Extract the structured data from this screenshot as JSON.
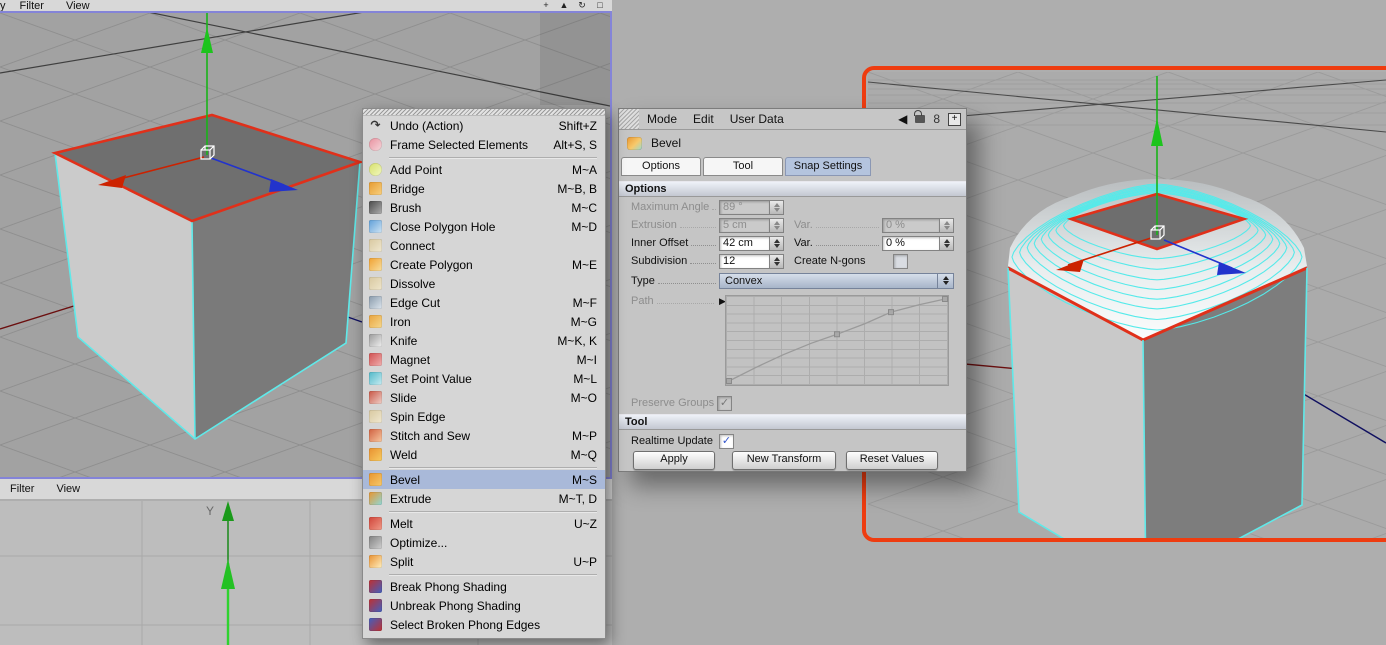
{
  "left_viewport": {
    "menu": [
      "y",
      "Filter",
      "View"
    ],
    "corner_icons": [
      {
        "name": "pan-icon",
        "glyph": "+"
      },
      {
        "name": "zoom-icon",
        "glyph": "▲"
      },
      {
        "name": "rotate-icon",
        "glyph": "↻"
      },
      {
        "name": "maximize-icon",
        "glyph": "□"
      }
    ]
  },
  "bottom_viewport": {
    "menu": [
      "Filter",
      "View"
    ],
    "y_axis_label": "Y"
  },
  "context_menu": {
    "items": [
      {
        "id": "undo",
        "label": "Undo (Action)",
        "shortcut": "Shift+Z",
        "icon": "undo-icon",
        "glyph": "↷",
        "fg": "#333"
      },
      {
        "id": "frame-selected-elements",
        "label": "Frame Selected Elements",
        "shortcut": "Alt+S, S",
        "icon": "frame-selected-icon",
        "c1": "#e8909e",
        "c2": "#f6d8dc",
        "round": true
      },
      {
        "sep": true
      },
      {
        "id": "add-point",
        "label": "Add Point",
        "shortcut": "M~A",
        "icon": "add-point-icon",
        "c1": "#d6e06a",
        "c2": "#f2f8c0",
        "round": true
      },
      {
        "id": "bridge",
        "label": "Bridge",
        "shortcut": "M~B, B",
        "icon": "bridge-icon",
        "c1": "#e69b30",
        "c2": "#f8d080"
      },
      {
        "id": "brush",
        "label": "Brush",
        "shortcut": "M~C",
        "icon": "brush-icon",
        "c1": "#4a4a4a",
        "c2": "#b0b0b0"
      },
      {
        "id": "close-polygon-hole",
        "label": "Close Polygon Hole",
        "shortcut": "M~D",
        "icon": "close-polygon-hole-icon",
        "c1": "#5f9fd8",
        "c2": "#cfe4f4"
      },
      {
        "id": "connect",
        "label": "Connect",
        "shortcut": "",
        "icon": "connect-icon",
        "c1": "#d8c8a0",
        "c2": "#f0e8d0"
      },
      {
        "id": "create-polygon",
        "label": "Create Polygon",
        "shortcut": "M~E",
        "icon": "create-polygon-icon",
        "c1": "#f0a030",
        "c2": "#f8e0a0"
      },
      {
        "id": "dissolve",
        "label": "Dissolve",
        "shortcut": "",
        "icon": "dissolve-icon",
        "c1": "#d8c8a0",
        "c2": "#efe6cc"
      },
      {
        "id": "edge-cut",
        "label": "Edge Cut",
        "shortcut": "M~F",
        "icon": "edge-cut-icon",
        "c1": "#8899aa",
        "c2": "#dde6ee"
      },
      {
        "id": "iron",
        "label": "Iron",
        "shortcut": "M~G",
        "icon": "iron-icon",
        "c1": "#e8a33d",
        "c2": "#f6d88e"
      },
      {
        "id": "knife",
        "label": "Knife",
        "shortcut": "M~K, K",
        "icon": "knife-icon",
        "c1": "#9a9a9a",
        "c2": "#f0f0f0"
      },
      {
        "id": "magnet",
        "label": "Magnet",
        "shortcut": "M~I",
        "icon": "magnet-icon",
        "c1": "#d05050",
        "c2": "#f0b0b0"
      },
      {
        "id": "set-point-value",
        "label": "Set Point Value",
        "shortcut": "M~L",
        "icon": "set-point-value-icon",
        "c1": "#50b8c8",
        "c2": "#c8ecf2"
      },
      {
        "id": "slide",
        "label": "Slide",
        "shortcut": "M~O",
        "icon": "slide-icon",
        "c1": "#c85545",
        "c2": "#f0d0c8"
      },
      {
        "id": "spin-edge",
        "label": "Spin Edge",
        "shortcut": "",
        "icon": "spin-edge-icon",
        "c1": "#d8c8a0",
        "c2": "#f0e8d0"
      },
      {
        "id": "stitch-and-sew",
        "label": "Stitch and Sew",
        "shortcut": "M~P",
        "icon": "stitch-and-sew-icon",
        "c1": "#d06040",
        "c2": "#f8c8a0"
      },
      {
        "id": "weld",
        "label": "Weld",
        "shortcut": "M~Q",
        "icon": "weld-icon",
        "c1": "#e89030",
        "c2": "#f8cc60"
      },
      {
        "sep": true
      },
      {
        "id": "bevel",
        "label": "Bevel",
        "shortcut": "M~S",
        "icon": "bevel-icon",
        "c1": "#e8952f",
        "c2": "#f7c96b",
        "highlighted": true
      },
      {
        "id": "extrude",
        "label": "Extrude",
        "shortcut": "M~T, D",
        "icon": "extrude-icon",
        "c1": "#e8952f",
        "c2": "#8fd8d8"
      },
      {
        "sep": true
      },
      {
        "id": "melt",
        "label": "Melt",
        "shortcut": "U~Z",
        "icon": "melt-icon",
        "c1": "#d04438",
        "c2": "#f09a88"
      },
      {
        "id": "optimize",
        "label": "Optimize...",
        "shortcut": "",
        "icon": "optimize-icon",
        "c1": "#808080",
        "c2": "#d0d0d0"
      },
      {
        "id": "split",
        "label": "Split",
        "shortcut": "U~P",
        "icon": "split-icon",
        "c1": "#e89030",
        "c2": "#fff0c0"
      },
      {
        "sep": true
      },
      {
        "id": "break-phong-shading",
        "label": "Break Phong Shading",
        "shortcut": "",
        "icon": "break-phong-icon",
        "c1": "#c03030",
        "c2": "#4060c0"
      },
      {
        "id": "unbreak-phong-shading",
        "label": "Unbreak Phong Shading",
        "shortcut": "",
        "icon": "unbreak-phong-icon",
        "c1": "#c03030",
        "c2": "#4060c0"
      },
      {
        "id": "select-broken-phong-edges",
        "label": "Select Broken Phong Edges",
        "shortcut": "",
        "icon": "select-broken-phong-icon",
        "c1": "#4060c0",
        "c2": "#c03030"
      }
    ]
  },
  "attributes_panel": {
    "menu": [
      "Mode",
      "Edit",
      "User Data"
    ],
    "tool_title": "Bevel",
    "tabs": [
      {
        "label": "Options",
        "active": true
      },
      {
        "label": "Tool",
        "active": true
      },
      {
        "label": "Snap Settings",
        "active": false
      }
    ],
    "options_section": {
      "title": "Options",
      "maximum_angle": {
        "label": "Maximum Angle",
        "value": "89 °",
        "disabled": true
      },
      "extrusion": {
        "label": "Extrusion",
        "value": "5 cm",
        "var_label": "Var.",
        "var_value": "0 %",
        "disabled": true
      },
      "inner_offset": {
        "label": "Inner Offset",
        "value": "42 cm",
        "var_label": "Var.",
        "var_value": "0 %",
        "disabled": false
      },
      "subdivision": {
        "label": "Subdivision",
        "value": "12",
        "ngons_label": "Create N-gons",
        "ngons_checked": false
      },
      "type": {
        "label": "Type",
        "value": "Convex"
      },
      "path": {
        "label": "Path",
        "curve_points": [
          [
            0,
            0
          ],
          [
            0.12,
            0.16
          ],
          [
            0.25,
            0.32
          ],
          [
            0.38,
            0.46
          ],
          [
            0.5,
            0.57
          ],
          [
            0.63,
            0.7
          ],
          [
            0.75,
            0.84
          ],
          [
            0.88,
            0.93
          ],
          [
            1,
            1
          ]
        ],
        "handle_points": [
          [
            0,
            0
          ],
          [
            0.5,
            0.57
          ],
          [
            0.75,
            0.84
          ],
          [
            1,
            1
          ]
        ],
        "grid": {
          "cols": 8,
          "rows": 10
        }
      },
      "preserve_groups": {
        "label": "Preserve Groups",
        "checked": true,
        "disabled": true
      }
    },
    "tool_section": {
      "title": "Tool",
      "realtime_label": "Realtime Update",
      "realtime_checked": true,
      "buttons": [
        "Apply",
        "New Transform",
        "Reset Values"
      ]
    }
  },
  "colors": {
    "selection_highlight": "#a9b9d9",
    "active_viewport_border": "#ee3c10",
    "viewport_border": "#8484d8",
    "selected_edge": "#e0301a",
    "unselected_edge": "#5fe9e9",
    "axis_x": "#cc2200",
    "axis_y": "#22bb22",
    "axis_z": "#2233cc",
    "snap_tab": "#b4c4de"
  }
}
